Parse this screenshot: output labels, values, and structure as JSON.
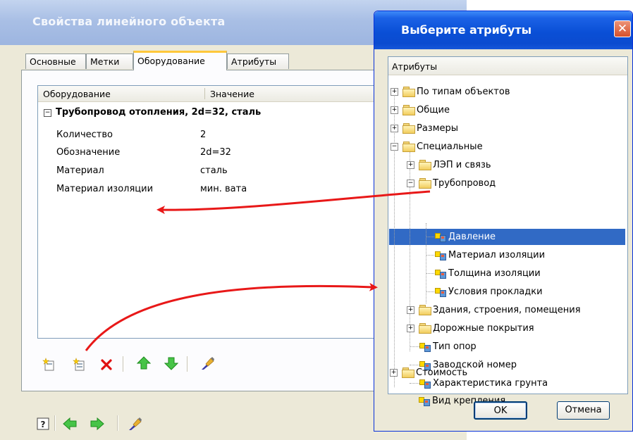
{
  "props_window": {
    "title": "Свойства линейного объекта",
    "tabs": [
      "Основные",
      "Метки",
      "Оборудование",
      "Атрибуты"
    ],
    "active_tab": "Оборудование",
    "grid": {
      "columns": [
        "Оборудование",
        "Значение"
      ],
      "group": {
        "expander": "−",
        "label": "Трубопровод отопления, 2d=32, сталь"
      },
      "rows": [
        {
          "name": "Количество",
          "value": "2"
        },
        {
          "name": "Обозначение",
          "value": "2d=32"
        },
        {
          "name": "Материал",
          "value": "сталь"
        },
        {
          "name": "Материал изоляции",
          "value": "мин. вата"
        }
      ]
    },
    "toolbar": [
      "add-icon",
      "add-copy-icon",
      "delete-icon",
      "move-up-icon",
      "move-down-icon",
      "paint-icon"
    ],
    "bottom_toolbar": [
      "help-icon",
      "back-icon",
      "forward-icon",
      "paint-icon"
    ]
  },
  "attr_dialog": {
    "title": "Выберите атрибуты",
    "close_glyph": "✕",
    "header": "Атрибуты",
    "tree": [
      {
        "label": "По типам объектов",
        "level": 0,
        "type": "folder",
        "expander": "+"
      },
      {
        "label": "Общие",
        "level": 0,
        "type": "folder",
        "expander": "+"
      },
      {
        "label": "Размеры",
        "level": 0,
        "type": "folder",
        "expander": "+"
      },
      {
        "label": "Специальные",
        "level": 0,
        "type": "folder",
        "expander": "−"
      },
      {
        "label": "ЛЭП и связь",
        "level": 1,
        "type": "folder",
        "expander": "+"
      },
      {
        "label": "Трубопровод",
        "level": 1,
        "type": "folder",
        "expander": "−"
      },
      {
        "label": "Давление",
        "level": 2,
        "type": "attribute",
        "selected": true
      },
      {
        "label": "Материал изоляции",
        "level": 2,
        "type": "attribute"
      },
      {
        "label": "Толщина изоляции",
        "level": 2,
        "type": "attribute"
      },
      {
        "label": "Условия прокладки",
        "level": 2,
        "type": "attribute"
      },
      {
        "label": "Здания, строения, помещения",
        "level": 1,
        "type": "folder",
        "expander": "+"
      },
      {
        "label": "Дорожные покрытия",
        "level": 1,
        "type": "folder",
        "expander": "+"
      },
      {
        "label": "Тип опор",
        "level": 1,
        "type": "attribute"
      },
      {
        "label": "Заводской номер",
        "level": 1,
        "type": "attribute"
      },
      {
        "label": "Характеристика грунта",
        "level": 1,
        "type": "attribute"
      },
      {
        "label": "Вид крепления",
        "level": 1,
        "type": "attribute"
      },
      {
        "label": "Стоимость",
        "level": 0,
        "type": "folder",
        "expander": "+"
      }
    ],
    "ok_label": "OK",
    "cancel_label": "Отмена"
  },
  "colors": {
    "selection": "#316ac5",
    "arrow": "#e81818",
    "titlebar_active": "#0a4fd6"
  }
}
